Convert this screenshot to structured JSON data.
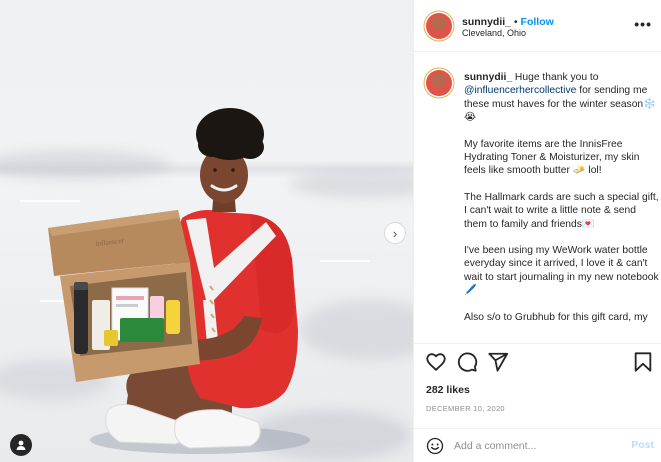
{
  "post": {
    "username": "sunnydii_",
    "separator": "•",
    "follow_label": "Follow",
    "location": "Cleveland, Ohio",
    "more_label": "•••"
  },
  "caption": {
    "username": "sunnydii_",
    "p1_before": " Huge thank you to ",
    "mention": "@influencerhercollective",
    "p1_after": " for sending me these must haves for the winter season❄️😭",
    "p2": "My favorite items are the InnisFree Hydrating Toner & Moisturizer, my skin feels like smooth butter 🧈 lol!",
    "p3": "The Hallmark cards are such a special gift, I can't wait to write a little note & send them to family and friends💌",
    "p4": "I've been using my WeWork water bottle everyday since it arrived, I love it & can't wait to start journaling in my new notebook🖊️",
    "p5": "Also s/o to Grubhub for this gift card, my"
  },
  "engagement": {
    "likes": "282 likes",
    "date": "December 10, 2020"
  },
  "comment": {
    "placeholder": "Add a comment...",
    "post_label": "Post"
  },
  "media": {
    "next_glyph": "›"
  },
  "icons": {
    "like": "heart-icon",
    "comment": "comment-icon",
    "share": "paper-plane-icon",
    "save": "bookmark-icon",
    "emoji": "smiley-icon",
    "user_tag": "user-icon"
  },
  "colors": {
    "follow": "#0095f6",
    "mention": "#00376b",
    "post_disabled": "#b2dffc",
    "secondary_text": "#8e8e8e"
  }
}
